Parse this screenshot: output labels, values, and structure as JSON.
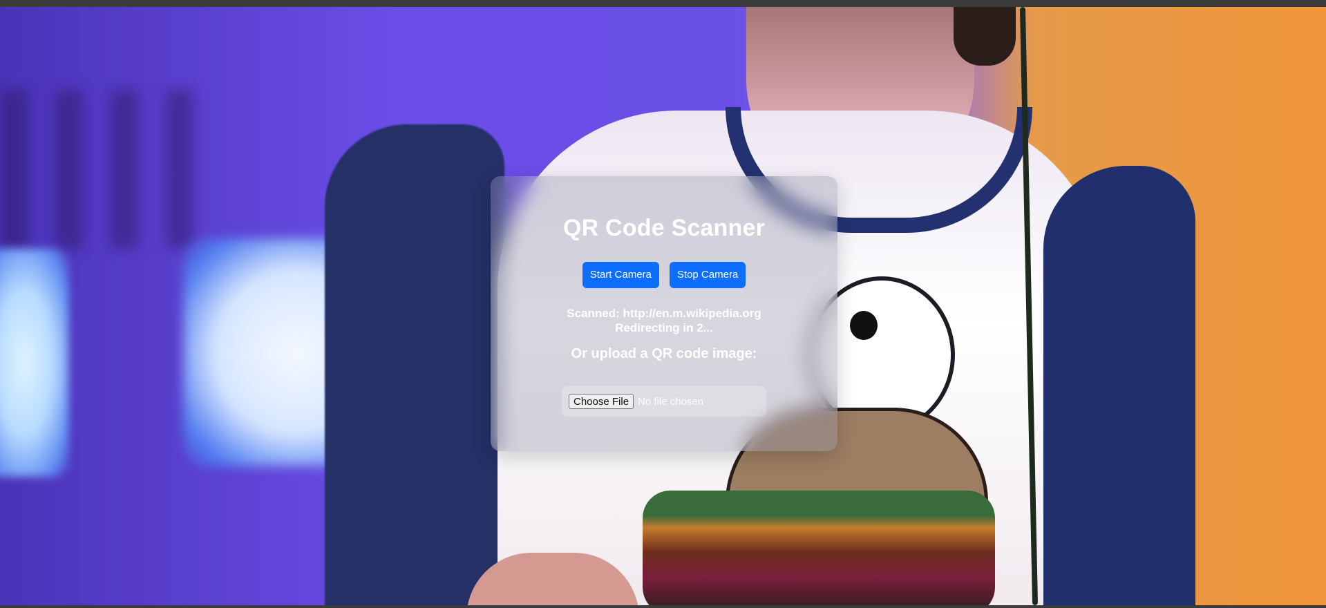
{
  "scanner": {
    "title": "QR Code Scanner",
    "start_camera_label": "Start Camera",
    "stop_camera_label": "Stop Camera",
    "status_line1": "Scanned: http://en.m.wikipedia.org",
    "status_line2": "Redirecting in 2...",
    "upload_heading": "Or upload a QR code image:",
    "choose_file_label": "Choose File",
    "file_status": "No file chosen"
  },
  "colors": {
    "primary_button": "#0d6efd",
    "card_text": "#ffffff"
  }
}
